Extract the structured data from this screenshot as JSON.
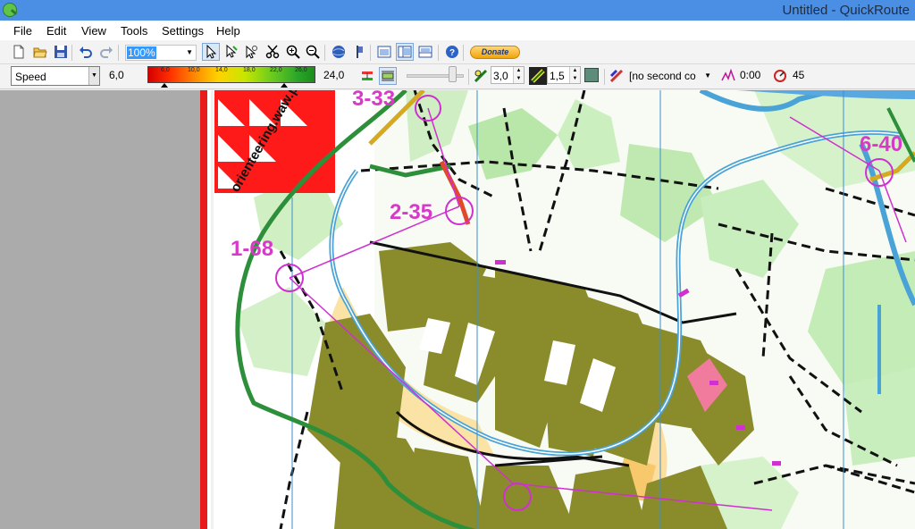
{
  "window": {
    "title": "Untitled - QuickRoute"
  },
  "menu": {
    "file": "File",
    "edit": "Edit",
    "view": "View",
    "tools": "Tools",
    "settings": "Settings",
    "help": "Help"
  },
  "toolbar": {
    "zoom_value": "100%",
    "donate_label": "Donate",
    "icons": [
      "new-icon",
      "open-icon",
      "save-icon",
      "undo-icon",
      "redo-icon",
      "pointer-icon",
      "adjust-route-icon",
      "zoom-route-icon",
      "cut-icon",
      "zoom-in-icon",
      "zoom-out-icon",
      "globe-icon",
      "flag-icon",
      "single-pane-icon",
      "split-pane-icon",
      "laps-pane-icon",
      "help-icon"
    ]
  },
  "gradient_bar": {
    "property": "Speed",
    "low_value": "6,0",
    "high_value": "24,0",
    "ticks": [
      "6,0",
      "10,0",
      "14,0",
      "18,0",
      "22,0",
      "26,0"
    ],
    "route_line_width": "3,0",
    "route_mask_width": "1,5",
    "second_property": "[no second co",
    "time_value": "0:00",
    "smoothing_value": "45",
    "colors": {
      "low": "#d40000",
      "mid": "#ffd200",
      "high": "#1b8d1b"
    }
  },
  "map": {
    "controls": [
      {
        "label": "3-33"
      },
      {
        "label": "2-35"
      },
      {
        "label": "1-68"
      },
      {
        "label": "6-40"
      }
    ],
    "logo_text": "orienteering.waw.pl",
    "route_color": "#cf30cf"
  }
}
